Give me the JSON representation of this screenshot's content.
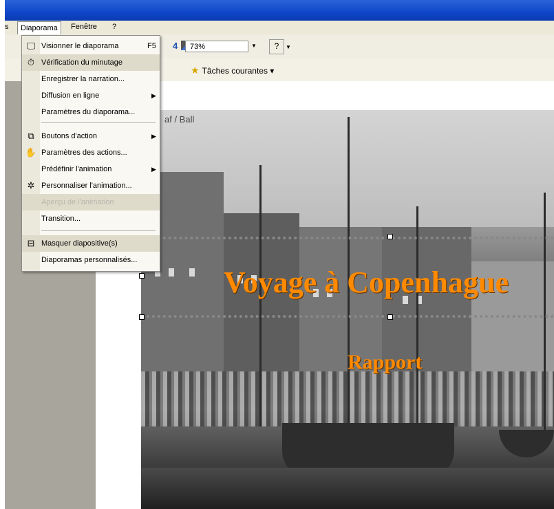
{
  "menubar": {
    "items": [
      "s",
      "Diaporama",
      "Fenêtre",
      "?"
    ]
  },
  "toolbar": {
    "zoom_value": "73%",
    "help_label": "?",
    "tasks_label": "Tâches courantes"
  },
  "menu": {
    "items": [
      {
        "label": "Visionner le diaporama",
        "shortcut": "F5",
        "icon": "projector-icon"
      },
      {
        "label": "Vérification du minutage",
        "icon": "timer-icon"
      },
      {
        "label": "Enregistrer la narration...",
        "icon": ""
      },
      {
        "label": "Diffusion en ligne",
        "submenu": true
      },
      {
        "label": "Paramètres du diaporama...",
        "icon": ""
      },
      {
        "label": "Boutons d'action",
        "submenu": true,
        "icon": "action-buttons-icon"
      },
      {
        "label": "Paramètres des actions...",
        "icon": "action-settings-icon"
      },
      {
        "label": "Prédéfinir l'animation",
        "submenu": true
      },
      {
        "label": "Personnaliser l'animation...",
        "icon": "custom-animation-icon"
      },
      {
        "label": "Aperçu de l'animation",
        "disabled": true
      },
      {
        "label": "Transition...",
        "icon": ""
      },
      {
        "label": "Masquer diapositive(s)",
        "icon": "hide-slide-icon"
      },
      {
        "label": "Diaporamas personnalisés...",
        "icon": ""
      }
    ]
  },
  "slide": {
    "credit": "af / Ball",
    "title": "Voyage à Copenhague",
    "subtitle": "Rapport"
  }
}
